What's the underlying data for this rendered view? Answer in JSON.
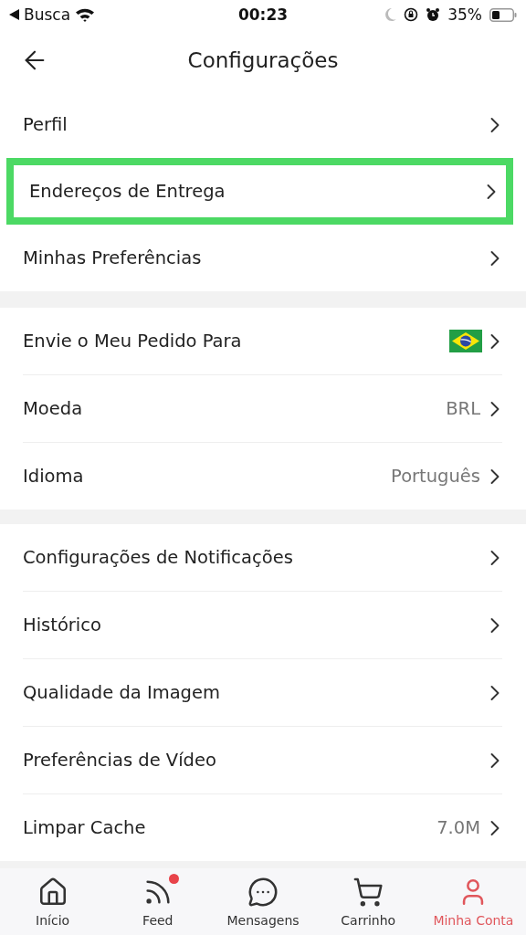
{
  "status_bar": {
    "back_app": "Busca",
    "time": "00:23",
    "battery": "35%"
  },
  "header": {
    "title": "Configurações"
  },
  "sections": [
    {
      "items": [
        {
          "label": "Perfil",
          "highlighted": false
        },
        {
          "label": "Endereços de Entrega",
          "highlighted": true
        },
        {
          "label": "Minhas Preferências",
          "highlighted": false
        }
      ]
    },
    {
      "items": [
        {
          "label": "Envie o Meu Pedido Para",
          "kind": "flag",
          "highlighted": false
        },
        {
          "label": "Moeda",
          "kind": "value",
          "value": "BRL",
          "highlighted": false
        },
        {
          "label": "Idioma",
          "kind": "value",
          "value": "Português",
          "highlighted": false
        }
      ]
    },
    {
      "items": [
        {
          "label": "Configurações de Notificações",
          "highlighted": false
        },
        {
          "label": "Histórico",
          "highlighted": false
        },
        {
          "label": "Qualidade da Imagem",
          "highlighted": false
        },
        {
          "label": "Preferências de Vídeo",
          "highlighted": false
        },
        {
          "label": "Limpar Cache",
          "kind": "value",
          "value": "7.0M",
          "highlighted": false
        }
      ]
    }
  ],
  "bottom_nav": [
    {
      "label": "Início",
      "kind": "home",
      "selected": false,
      "badge": false
    },
    {
      "label": "Feed",
      "kind": "feed",
      "selected": false,
      "badge": true
    },
    {
      "label": "Mensagens",
      "kind": "chat",
      "selected": false,
      "badge": false
    },
    {
      "label": "Carrinho",
      "kind": "cart",
      "selected": false,
      "badge": false
    },
    {
      "label": "Minha Conta",
      "kind": "user",
      "selected": true,
      "badge": false
    }
  ]
}
